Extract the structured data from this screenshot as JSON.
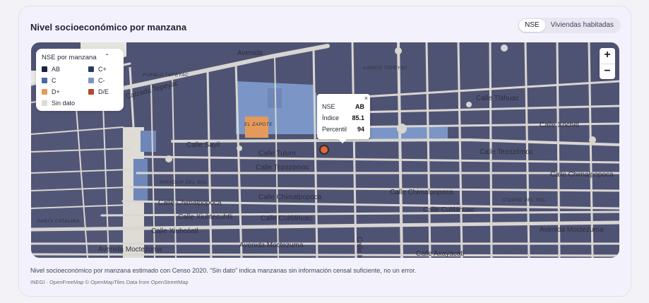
{
  "card": {
    "title": "Nivel socioeconómico por manzana"
  },
  "toggle": {
    "options": [
      "NSE",
      "Viviendas habitadas"
    ],
    "selected": "NSE"
  },
  "legend": {
    "title": "NSE por manzana",
    "items": [
      {
        "label": "AB",
        "color": "#1e2140"
      },
      {
        "label": "C+",
        "color": "#2f3a5e"
      },
      {
        "label": "C",
        "color": "#4a69a4"
      },
      {
        "label": "C-",
        "color": "#7b96c6"
      },
      {
        "label": "D+",
        "color": "#e39a5a"
      },
      {
        "label": "D/E",
        "color": "#b5472a"
      },
      {
        "label": "Sin dato",
        "color": "#dcdcd8"
      }
    ]
  },
  "zoom": {
    "in": "+",
    "out": "−"
  },
  "popup": {
    "close": "×",
    "nse_label": "NSE",
    "nse_value": "AB",
    "indice_label": "Índice",
    "indice_value": "85.1",
    "percentil_label": "Percentil",
    "percentil_value": "94"
  },
  "map_labels": {
    "avenida_top": "Avenida",
    "tepeyac": "Calzada Tepeyac",
    "pueblo_tepeyac": "PUEBLO TEPEYAC",
    "lindos_tepeyac": "LINDOS TEPEYAC",
    "calle_tlahuac": "Calle Tláhuac",
    "calle_xochitl": "Calle Xóchitl",
    "calle_tezozomoc_e": "Calle Tezozómoc",
    "calle_tulum": "Calle Tulum",
    "calle_tezozomoc": "Calle Tezozómoc",
    "calle_sayil": "Calle Sayil",
    "el_zapote": "EL ZAPOTE",
    "mirador_del_sol": "MIRADOR DEL SOL",
    "calle_chimalpopoca_w": "Calle Chimalpopoca",
    "calle_chimalpopoca": "Calle Chimalpopoca",
    "calle_chimalpopoca_e": "Calle Chimalpopoca",
    "calle_chimalpopoca_ne": "Calle Chimalpopoca",
    "ciudad_del_sol": "CIUDAD DEL SOL",
    "calle_xiuhtecuhtli": "Calle Xiuhtecuhtli",
    "calle_cuitlahuac": "Calle Cuitláhuac",
    "calle_cuitlahuac_e": "Calle Cuitláhuac",
    "santa_catalina": "SANTA CATALINA",
    "calle_xiuhcoatl": "Calle Xiuhcóatl",
    "av_moctezuma_e": "Avenida Moctezuma",
    "av_moctezuma_w": "Avenida Moctezuma",
    "av_moctezuma_mid": "Avenida Moctezuma",
    "calle_axayacatl": "Calle Axayácatl",
    "calle_kabah": "Calle Kabah"
  },
  "footer": {
    "note": "Nivel socioeconómico por manzana estimado con Censo 2020. “Sin dato” indica manzanas sin información censal suficiente, no un error.",
    "attribution": "INEGI · OpenFreeMap © OpenMapTiles Data from OpenStreetMap"
  }
}
